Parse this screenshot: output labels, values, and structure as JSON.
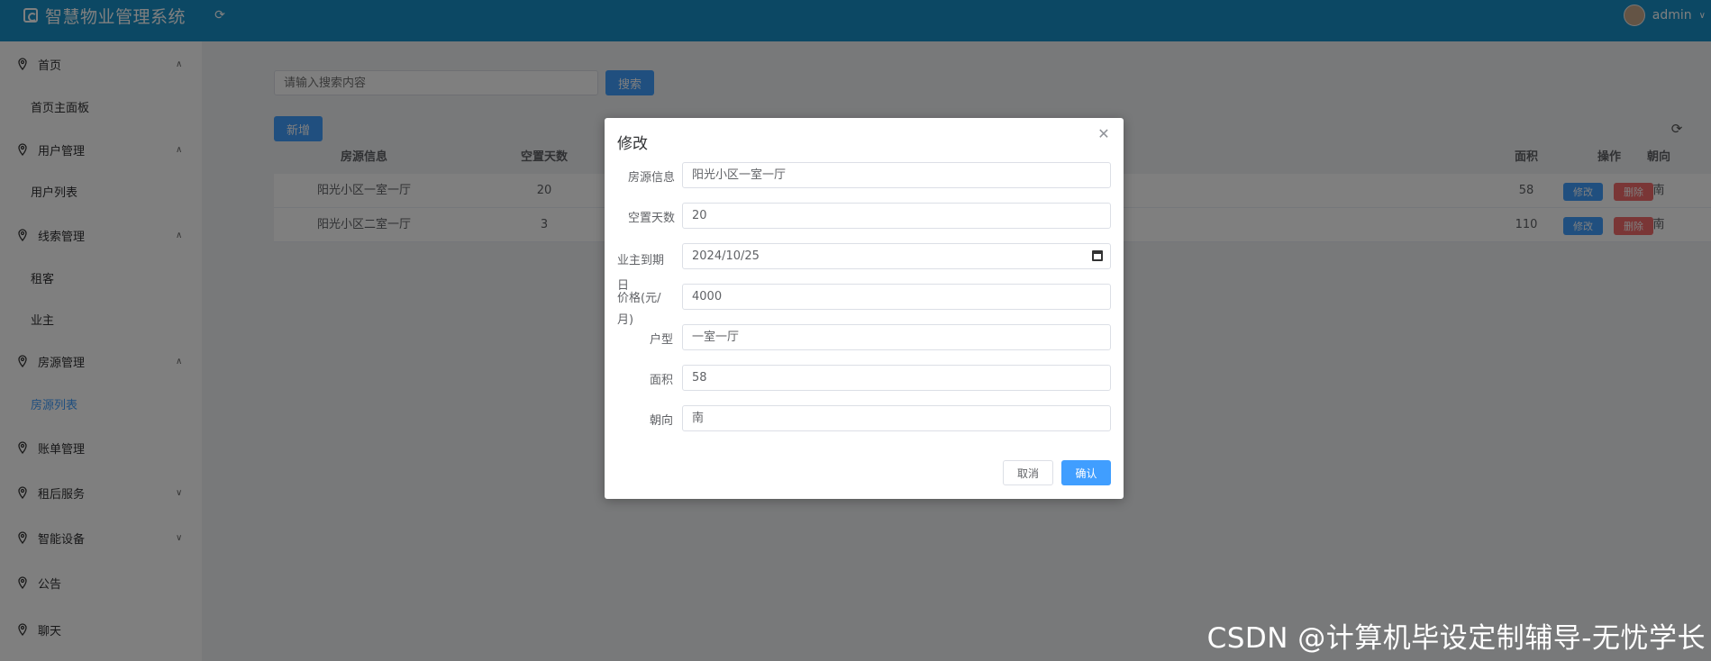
{
  "header": {
    "app_title": "智慧物业管理系统",
    "user_name": "admin"
  },
  "sidebar": {
    "items": [
      {
        "label": "首页",
        "chevron": "chevron-up-icon"
      },
      {
        "label": "首页主面板"
      },
      {
        "label": "用户管理",
        "chevron": "chevron-up-icon"
      },
      {
        "label": "用户列表"
      },
      {
        "label": "线索管理",
        "chevron": "chevron-up-icon"
      },
      {
        "label": "租客"
      },
      {
        "label": "业主"
      },
      {
        "label": "房源管理",
        "chevron": "chevron-up-icon"
      },
      {
        "label": "房源列表",
        "active": true
      },
      {
        "label": "账单管理"
      },
      {
        "label": "租后服务",
        "chevron": "chevron-down-icon"
      },
      {
        "label": "智能设备",
        "chevron": "chevron-down-icon"
      },
      {
        "label": "公告"
      },
      {
        "label": "聊天"
      }
    ]
  },
  "toolbar": {
    "search_placeholder": "请输入搜索内容",
    "search_label": "搜索",
    "add_label": "新增"
  },
  "table": {
    "columns": [
      "房源信息",
      "空置天数",
      "面积",
      "朝向",
      "操作"
    ],
    "rows": [
      {
        "info": "阳光小区一室一厅",
        "vacant_days": "20",
        "area": "58",
        "orientation": "南",
        "edit": "修改",
        "delete": "删除"
      },
      {
        "info": "阳光小区二室一厅",
        "vacant_days": "3",
        "area": "110",
        "orientation": "南",
        "edit": "修改",
        "delete": "删除"
      }
    ]
  },
  "dialog": {
    "title": "修改",
    "fields": [
      {
        "label": "房源信息",
        "value": "阳光小区一室一厅"
      },
      {
        "label": "空置天数",
        "value": "20"
      },
      {
        "label": "业主到期日",
        "value": "2024/10/25"
      },
      {
        "label": "价格(元/月)",
        "value": "4000"
      },
      {
        "label": "户型",
        "value": "一室一厅"
      },
      {
        "label": "面积",
        "value": "58"
      },
      {
        "label": "朝向",
        "value": "南"
      }
    ],
    "cancel_label": "取消",
    "confirm_label": "确认"
  },
  "watermark": "CSDN @计算机毕设定制辅导-无忧学长",
  "colors": {
    "header": "#1890c8",
    "primary": "#409eff",
    "danger": "#f56c6c"
  }
}
